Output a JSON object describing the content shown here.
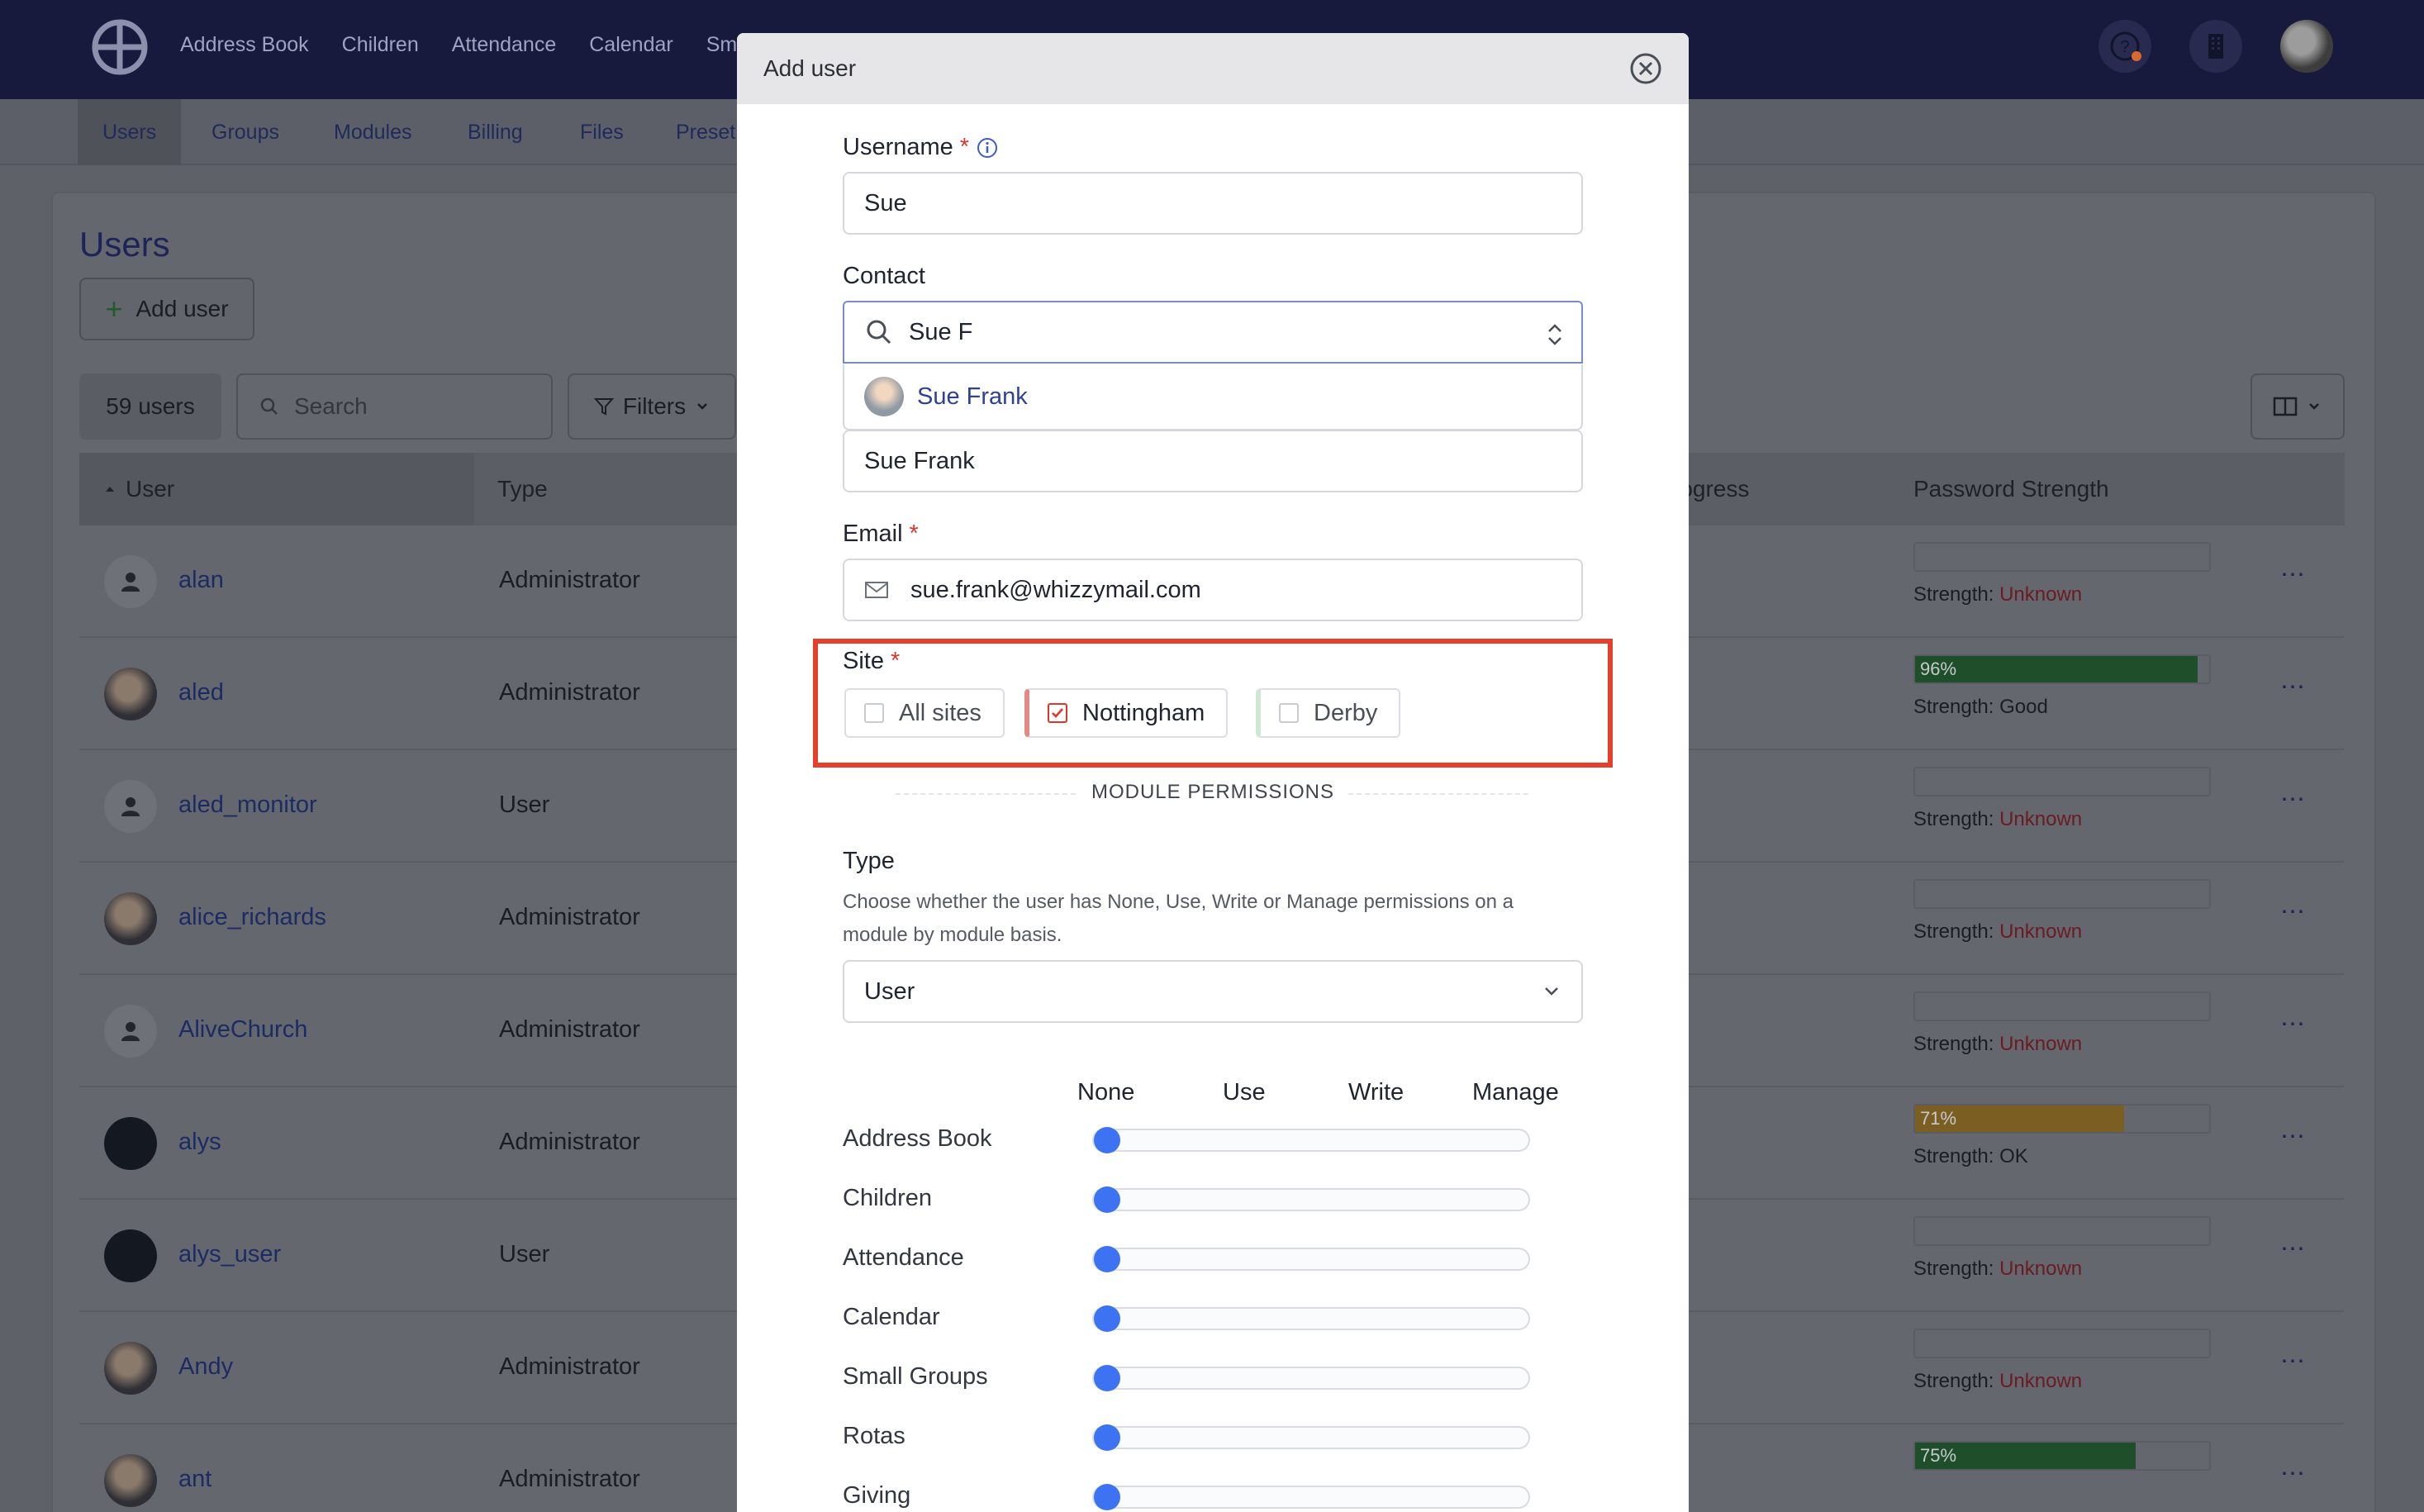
{
  "topnav": {
    "items": [
      "Address Book",
      "Children",
      "Attendance",
      "Calendar",
      "Sm"
    ]
  },
  "subnav": {
    "tabs": [
      "Users",
      "Groups",
      "Modules",
      "Billing",
      "Files",
      "Preset"
    ],
    "active": "Users"
  },
  "page": {
    "title": "Users",
    "add_user_label": "Add user",
    "count_label": "59 users",
    "search_placeholder": "Search",
    "filters_label": "Filters"
  },
  "table": {
    "columns": [
      "User",
      "Type",
      "rogress",
      "Password Strength"
    ],
    "rows": [
      {
        "name": "alan",
        "type": "Administrator",
        "strength": "Unknown",
        "pw_percent": null,
        "pw_label": ""
      },
      {
        "name": "aled",
        "type": "Administrator",
        "strength": "Good",
        "pw_percent": 96,
        "pw_label": "96%"
      },
      {
        "name": "aled_monitor",
        "type": "User",
        "strength": "Unknown",
        "pw_percent": null,
        "pw_label": ""
      },
      {
        "name": "alice_richards",
        "type": "Administrator",
        "strength": "Unknown",
        "pw_percent": null,
        "pw_label": ""
      },
      {
        "name": "AliveChurch",
        "type": "Administrator",
        "strength": "Unknown",
        "pw_percent": null,
        "pw_label": ""
      },
      {
        "name": "alys",
        "type": "Administrator",
        "strength": "OK",
        "pw_percent": 71,
        "pw_label": "71%"
      },
      {
        "name": "alys_user",
        "type": "User",
        "strength": "Unknown",
        "pw_percent": null,
        "pw_label": ""
      },
      {
        "name": "Andy",
        "type": "Administrator",
        "strength": "Unknown",
        "pw_percent": null,
        "pw_label": ""
      },
      {
        "name": "ant",
        "type": "Administrator",
        "strength": "",
        "pw_percent": 75,
        "pw_label": "75%"
      }
    ],
    "strength_prefix": "Strength:"
  },
  "modal": {
    "title": "Add user",
    "username_label": "Username",
    "username_value": "Sue",
    "contact_label": "Contact",
    "contact_search_value": "Sue F",
    "contact_option": "Sue Frank",
    "contact_selected": "Sue Frank",
    "email_label": "Email",
    "email_value": "sue.frank@whizzymail.com",
    "site_label": "Site",
    "sites": [
      {
        "label": "All sites",
        "checked": false
      },
      {
        "label": "Nottingham",
        "checked": true
      },
      {
        "label": "Derby",
        "checked": false
      }
    ],
    "section_title": "MODULE PERMISSIONS",
    "type_label": "Type",
    "type_help": "Choose whether the user has None, Use, Write or Manage permissions on a module by module basis.",
    "type_value": "User",
    "permission_levels": [
      "None",
      "Use",
      "Write",
      "Manage"
    ],
    "modules": [
      {
        "name": "Address Book",
        "level": "None"
      },
      {
        "name": "Children",
        "level": "None"
      },
      {
        "name": "Attendance",
        "level": "None"
      },
      {
        "name": "Calendar",
        "level": "None"
      },
      {
        "name": "Small Groups",
        "level": "None"
      },
      {
        "name": "Rotas",
        "level": "None"
      },
      {
        "name": "Giving",
        "level": "None"
      }
    ]
  },
  "colors": {
    "accent": "#3d73f2",
    "required": "#e0352b",
    "highlight": "#e4402c",
    "strength_good": "#2e7d3a",
    "strength_ok": "#c6962f"
  }
}
